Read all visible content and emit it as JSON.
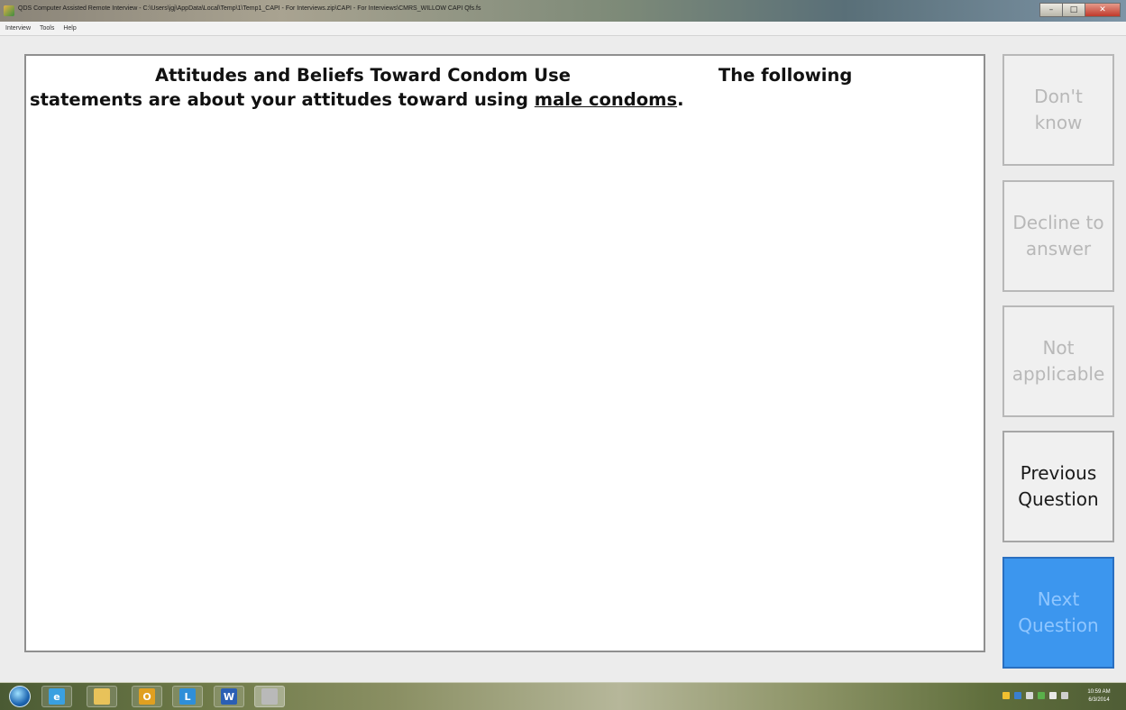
{
  "window": {
    "title": "QDS Computer Assisted Remote Interview - C:\\Users\\jgj\\AppData\\Local\\Temp\\1\\Temp1_CAPI - For Interviews.zip\\CAPI - For Interviews\\CMRS_WILLOW CAPI Qfs.fs",
    "minimize_label": "–",
    "maximize_label": "□",
    "close_label": "✕"
  },
  "menu": {
    "items": [
      "Interview",
      "Tools",
      "Help"
    ]
  },
  "question": {
    "title": "Attitudes and Beliefs Toward Condom Use",
    "intro": "The following",
    "body_before": "statements are about your attitudes toward using ",
    "body_underlined": "male condoms",
    "body_after": "."
  },
  "buttons": {
    "dont_know": {
      "line1": "Don't",
      "line2": "know",
      "enabled": false
    },
    "decline": {
      "line1": "Decline to",
      "line2": "answer",
      "enabled": false
    },
    "not_applicable": {
      "line1": "Not",
      "line2": "applicable",
      "enabled": false
    },
    "previous": {
      "line1": "Previous",
      "line2": "Question",
      "enabled": true
    },
    "next": {
      "line1": "Next",
      "line2": "Question",
      "enabled": true
    }
  },
  "taskbar": {
    "apps": [
      {
        "icon": "internet-explorer-icon",
        "glyph": "e",
        "color": "#3aa0e0"
      },
      {
        "icon": "file-explorer-icon",
        "glyph": "",
        "color": "#e8c25a"
      },
      {
        "icon": "outlook-icon",
        "glyph": "O",
        "color": "#e0a020"
      },
      {
        "icon": "lync-icon",
        "glyph": "L",
        "color": "#2f8fd8"
      },
      {
        "icon": "word-icon",
        "glyph": "W",
        "color": "#2b5fb4"
      },
      {
        "icon": "qds-app-icon",
        "glyph": "",
        "color": "#b9b9b9"
      }
    ],
    "clock_time": "10:59 AM",
    "clock_date": "6/3/2014"
  },
  "colors": {
    "accent": "#3c96ee",
    "disabled_text": "#b8b8b8",
    "panel_border": "#8f8f8f"
  }
}
